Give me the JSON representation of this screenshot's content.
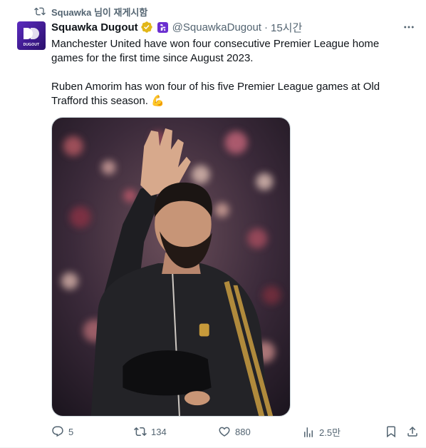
{
  "repost": {
    "label": "Squawka 님이 재게시함"
  },
  "author": {
    "display_name": "Squawka Dugout",
    "handle": "@SquawkaDugout",
    "time": "15시간",
    "avatar_text": "DUGOUT"
  },
  "tweet": {
    "paragraph1": "Manchester United have won four consecutive Premier League home games for the first time since August 2023.",
    "paragraph2": "Ruben Amorim has won four of his five Premier League games at Old Trafford this season. 💪"
  },
  "actions": {
    "replies": "5",
    "reposts": "134",
    "likes": "880",
    "views": "2.5만"
  },
  "colors": {
    "text": "#0f1419",
    "secondary": "#536471",
    "verified_gold": "#e2b719",
    "affiliate_purple": "#6b2fd0"
  },
  "icons": [
    "repost-icon",
    "verified-badge-icon",
    "affiliate-badge-icon",
    "more-icon",
    "reply-icon",
    "like-icon",
    "views-icon",
    "bookmark-icon",
    "share-icon"
  ]
}
